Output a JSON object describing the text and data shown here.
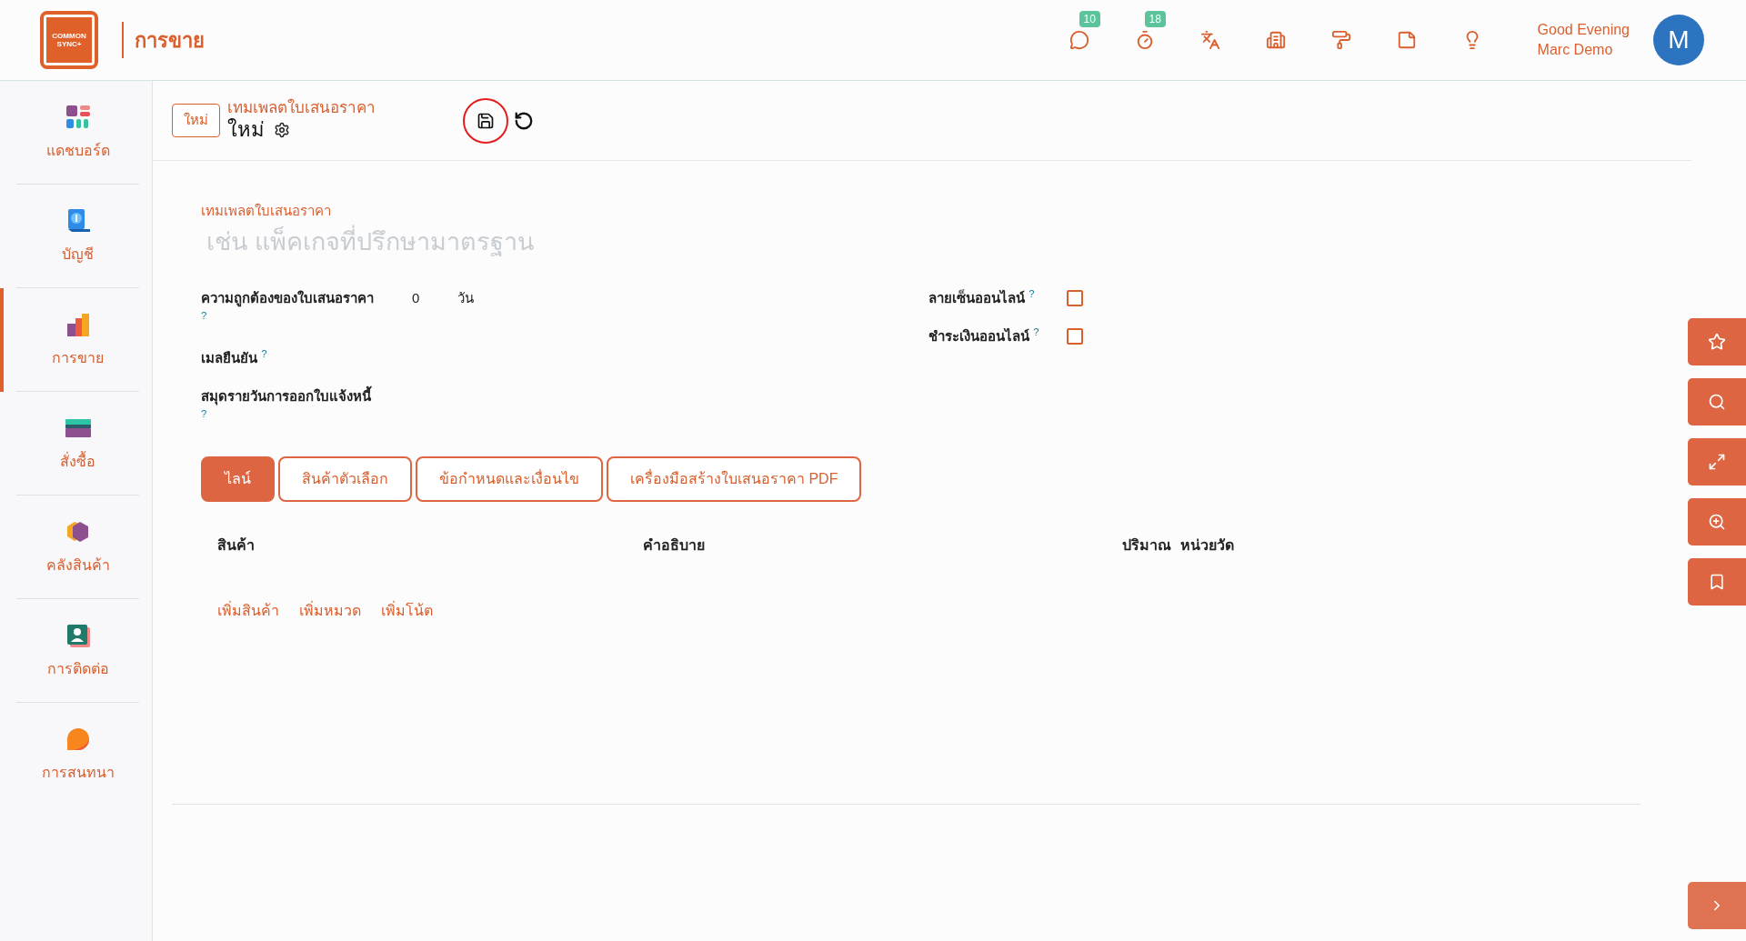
{
  "header": {
    "logo_lines": [
      "COMMON",
      "SYNC+"
    ],
    "app_title": "การขาย",
    "icons": [
      {
        "kind": "chat",
        "badge": "10"
      },
      {
        "kind": "timer",
        "badge": "18"
      },
      {
        "kind": "translate"
      },
      {
        "kind": "building"
      },
      {
        "kind": "paint"
      },
      {
        "kind": "note"
      },
      {
        "kind": "bulb"
      }
    ],
    "greeting": [
      "Good Evening",
      "Marc Demo"
    ],
    "avatar": "M"
  },
  "sidebar": {
    "items": [
      {
        "kind": "dashboard",
        "label": "แดชบอร์ด",
        "selected": false
      },
      {
        "kind": "accounting",
        "label": "บัญชี",
        "selected": false
      },
      {
        "kind": "sales",
        "label": "การขาย",
        "selected": true
      },
      {
        "kind": "purchase",
        "label": "สั่งซื้อ",
        "selected": false
      },
      {
        "kind": "inventory",
        "label": "คลังสินค้า",
        "selected": false
      },
      {
        "kind": "contacts",
        "label": "การติดต่อ",
        "selected": false
      },
      {
        "kind": "chat",
        "label": "การสนทนา",
        "selected": false
      }
    ]
  },
  "breadcrumb": {
    "badge": "ใหม่",
    "parent": "เทมเพลตใบเสนอราคา",
    "current": "ใหม่"
  },
  "form": {
    "name_label": "เทมเพลตใบเสนอราคา",
    "name_placeholder": "เช่น แพ็คเกจที่ปรึกษามาตรฐาน",
    "left_fields": [
      {
        "label": "ความถูกต้องของใบเสนอราคา",
        "help": "?",
        "value": "0",
        "unit": "วัน"
      },
      {
        "label": "เมลยืนยัน",
        "help": "?"
      },
      {
        "label": "สมุดรายวันการออกใบแจ้งหนี้",
        "help": "?"
      }
    ],
    "right_fields": [
      {
        "label": "ลายเซ็นออนไลน์",
        "help": "?",
        "checked": false
      },
      {
        "label": "ชำระเงินออนไลน์",
        "help": "?",
        "checked": false
      }
    ]
  },
  "tabs": [
    {
      "label": "ไลน์",
      "selected": true
    },
    {
      "label": "สินค้าตัวเลือก",
      "selected": false
    },
    {
      "label": "ข้อกำหนดและเงื่อนไข",
      "selected": false
    },
    {
      "label": "เครื่องมือสร้างใบเสนอราคา PDF",
      "selected": false
    }
  ],
  "table": {
    "columns": [
      "สินค้า",
      "คำอธิบาย",
      "ปริมาณ",
      "หน่วยวัด"
    ],
    "actions": [
      "เพิ่มสินค้า",
      "เพิ่มหมวด",
      "เพิ่มโน้ต"
    ]
  },
  "side_toolbar": [
    {
      "kind": "star"
    },
    {
      "kind": "search"
    },
    {
      "kind": "expand"
    },
    {
      "kind": "zoom"
    },
    {
      "kind": "bookmark"
    }
  ]
}
